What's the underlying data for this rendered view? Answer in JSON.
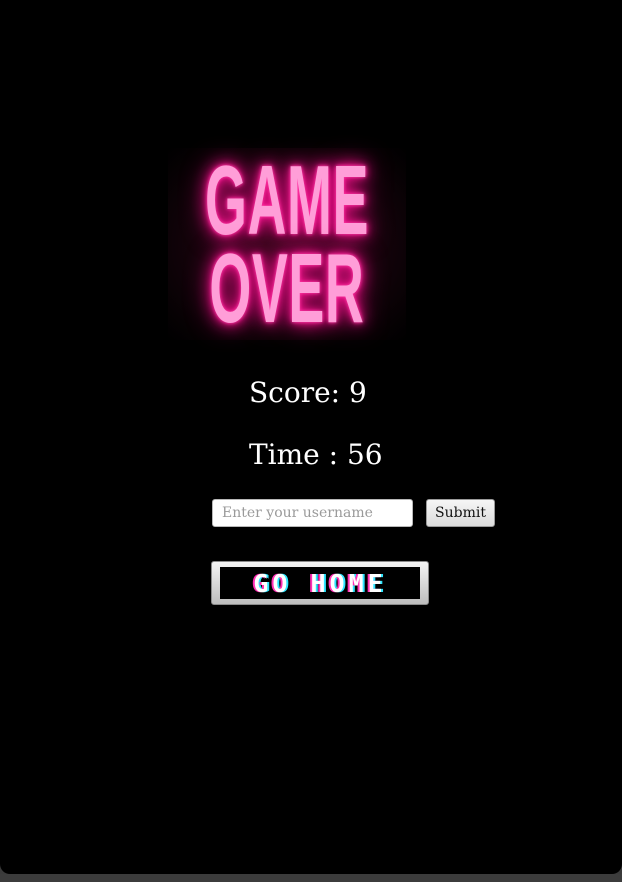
{
  "logo": {
    "line1": "GAME",
    "line2": "OVER",
    "glow_color": "#ff1493",
    "text_color": "#ff9ed8"
  },
  "stats": {
    "score": "Score: 9",
    "time": "Time : 56"
  },
  "form": {
    "username_placeholder": "Enter your username",
    "username_value": "",
    "submit_label": "Submit"
  },
  "home_button": {
    "label": "GO HOME"
  }
}
